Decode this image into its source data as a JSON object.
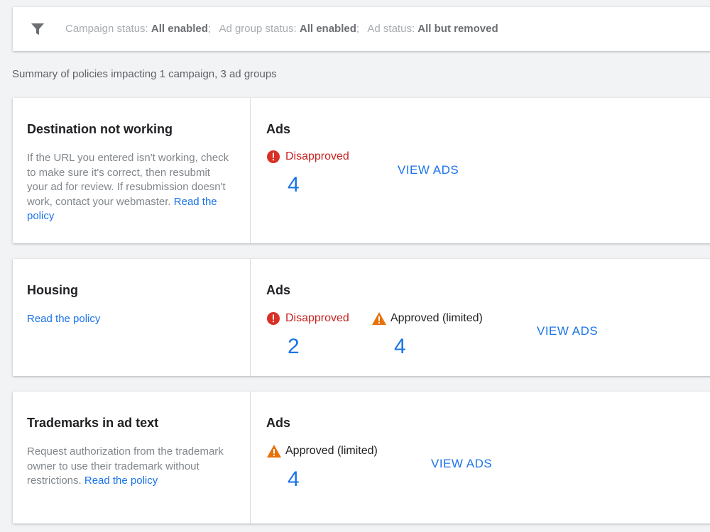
{
  "filter": {
    "items": [
      {
        "label": "Campaign status: ",
        "value": "All enabled",
        "sep": ";"
      },
      {
        "label": "Ad group status: ",
        "value": "All enabled",
        "sep": ";"
      },
      {
        "label": "Ad status: ",
        "value": "All but removed",
        "sep": ""
      }
    ]
  },
  "summary": "Summary of policies impacting 1 campaign, 3 ad groups",
  "cards": [
    {
      "title": "Destination not working",
      "description": "If the URL you entered isn't working, check to make sure it's correct, then resubmit your ad for review. If resubmission doesn't work, contact your webmaster.",
      "link": "Read the policy",
      "ads_label": "Ads",
      "statuses": [
        {
          "type": "disapproved",
          "label": "Disapproved",
          "count": "4"
        }
      ],
      "view_ads": "VIEW ADS"
    },
    {
      "title": "Housing",
      "description": "",
      "link": "Read the policy",
      "ads_label": "Ads",
      "statuses": [
        {
          "type": "disapproved",
          "label": "Disapproved",
          "count": "2"
        },
        {
          "type": "limited",
          "label": "Approved (limited)",
          "count": "4"
        }
      ],
      "view_ads": "VIEW ADS"
    },
    {
      "title": "Trademarks in ad text",
      "description": "Request authorization from the trademark owner to use their trademark without restrictions.",
      "link": "Read the policy",
      "ads_label": "Ads",
      "statuses": [
        {
          "type": "limited",
          "label": "Approved (limited)",
          "count": "4"
        }
      ],
      "view_ads": "VIEW ADS"
    }
  ],
  "colors": {
    "link": "#1a73e8",
    "disapproved": "#d93025",
    "limited": "#e8710a",
    "background": "#f1f3f4"
  }
}
